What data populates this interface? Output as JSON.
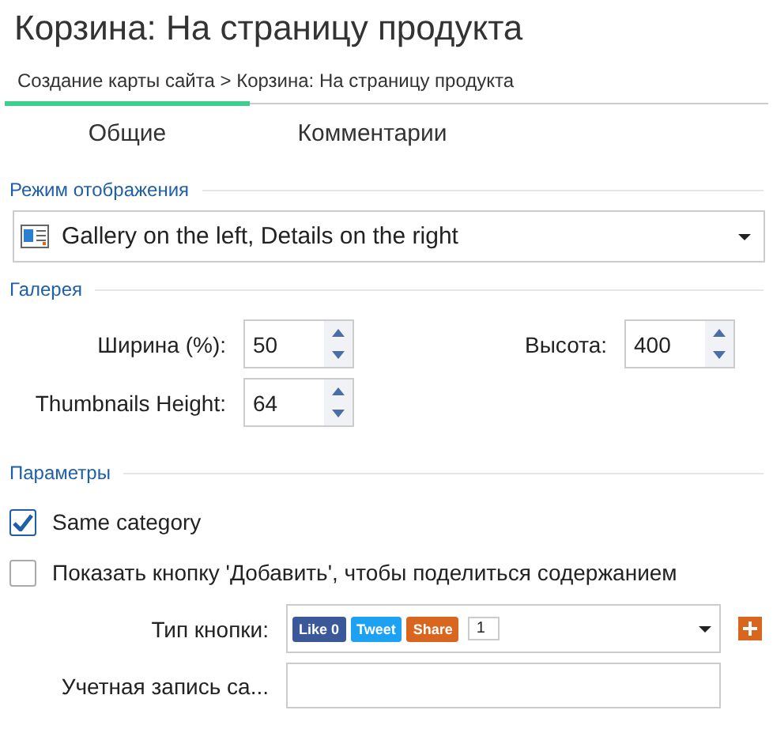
{
  "title": "Корзина: На страницу продукта",
  "breadcrumb": "Создание карты сайта > Корзина: На страницу продукта",
  "tabs": [
    {
      "label": "Общие",
      "selected": true
    },
    {
      "label": "Комментарии",
      "selected": false
    }
  ],
  "display_mode": {
    "legend": "Режим отображения",
    "value": "Gallery on the left, Details on the right"
  },
  "gallery": {
    "legend": "Галерея",
    "fields": [
      {
        "label": "Ширина (%):",
        "value": "50"
      },
      {
        "label": "Высота:",
        "value": "400"
      },
      {
        "label": "Thumbnails Height:",
        "value": "64"
      }
    ]
  },
  "parameters": {
    "legend": "Параметры",
    "checkboxes": [
      {
        "label": "Same category",
        "checked": true
      },
      {
        "label": "Показать кнопку 'Добавить', чтобы поделиться содержанием",
        "checked": false
      }
    ],
    "button_type": {
      "label": "Тип кнопки:",
      "preview": [
        {
          "kind": "like",
          "label": "Like",
          "count": "0"
        },
        {
          "kind": "tweet",
          "label": "Tweet"
        },
        {
          "kind": "share",
          "label": "Share"
        },
        {
          "kind": "counter",
          "label": "1"
        }
      ]
    },
    "account": {
      "label": "Учетная запись са..."
    }
  }
}
